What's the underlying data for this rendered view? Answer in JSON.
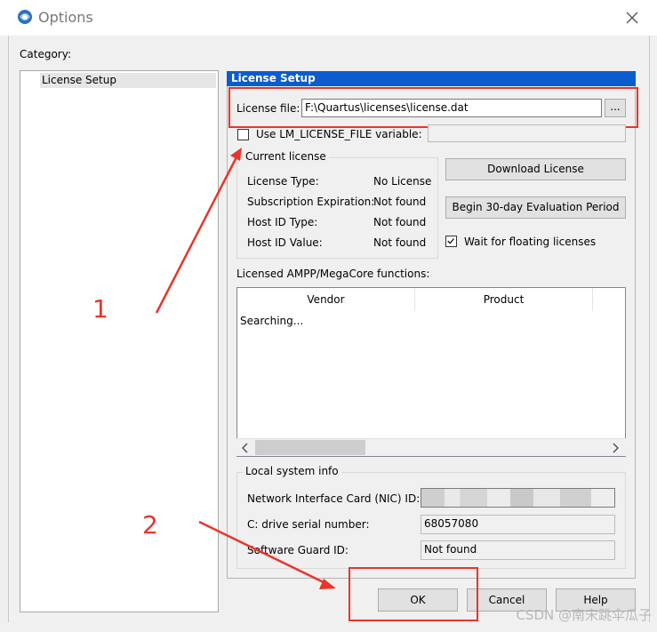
{
  "window": {
    "title": "Options"
  },
  "category": {
    "label": "Category:",
    "items": [
      "License Setup"
    ]
  },
  "panel": {
    "title": "License Setup",
    "license_file": {
      "label": "License file:",
      "value": "F:\\Quartus\\licenses\\license.dat",
      "browse_label": "..."
    },
    "lm_license": {
      "checkbox_label": "Use LM_LICENSE_FILE variable:",
      "checked": false,
      "value": ""
    },
    "current_license": {
      "title": "Current license",
      "rows": [
        {
          "label": "License Type:",
          "value": "No License"
        },
        {
          "label": "Subscription Expiration:",
          "value": "Not found"
        },
        {
          "label": "Host ID Type:",
          "value": "Not found"
        },
        {
          "label": "Host ID Value:",
          "value": "Not found"
        }
      ]
    },
    "download_button": "Download License",
    "evaluation_button": "Begin 30-day Evaluation Period",
    "floating": {
      "label": "Wait for floating licenses",
      "checked": true
    },
    "licensed_functions": {
      "label": "Licensed AMPP/MegaCore functions:",
      "columns": [
        "Vendor",
        "Product"
      ],
      "status": "Searching..."
    },
    "local_info": {
      "title": "Local system info",
      "nic_label": "Network Interface Card (NIC) ID:",
      "drive_label": "C: drive serial number:",
      "drive_value": "68057080",
      "guard_label": "Software Guard ID:",
      "guard_value": "Not found"
    }
  },
  "footer": {
    "ok": "OK",
    "cancel": "Cancel",
    "help": "Help"
  },
  "annotations": {
    "one": "1",
    "two": "2",
    "watermark": "CSDN @南宋跳伞瓜子"
  },
  "colors": {
    "annotation": "#e8352a",
    "header": "#0a5ccf"
  }
}
